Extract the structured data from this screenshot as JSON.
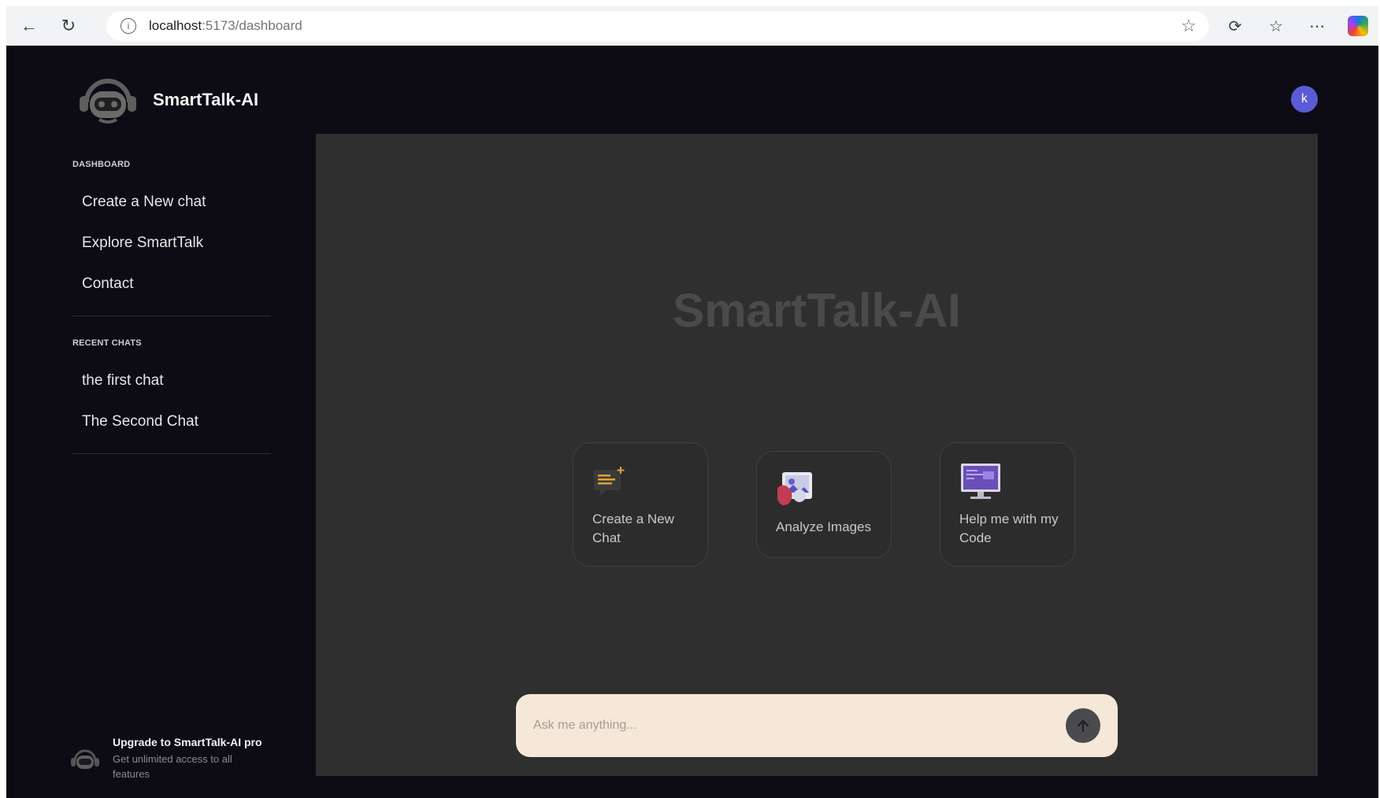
{
  "browser": {
    "url_host": "localhost",
    "url_path": ":5173/dashboard"
  },
  "app": {
    "name": "SmartTalk-AI"
  },
  "sidebar": {
    "dashboard_title": "DASHBOARD",
    "menu": [
      {
        "label": "Create a New chat"
      },
      {
        "label": "Explore SmartTalk"
      },
      {
        "label": "Contact"
      }
    ],
    "recent_title": "RECENT CHATS",
    "recent_chats": [
      {
        "label": "the first chat"
      },
      {
        "label": "The Second Chat"
      }
    ],
    "upgrade": {
      "title": "Upgrade to SmartTalk-AI pro",
      "description": "Get unlimited access to all features"
    }
  },
  "user": {
    "avatar_initial": "k",
    "avatar_color": "#5b5bd6"
  },
  "main": {
    "title": "SmartTalk-AI",
    "options": [
      {
        "label": "Create a New Chat",
        "icon": "chat-icon"
      },
      {
        "label": "Analyze Images",
        "icon": "image-icon"
      },
      {
        "label": "Help me with my Code",
        "icon": "code-icon"
      }
    ],
    "prompt": {
      "placeholder": "Ask me anything..."
    }
  },
  "colors": {
    "app_background": "#0d0b14",
    "main_panel": "#2f2f2f",
    "prompt_bar": "#f5e8d8",
    "accent": "#5b5bd6"
  }
}
